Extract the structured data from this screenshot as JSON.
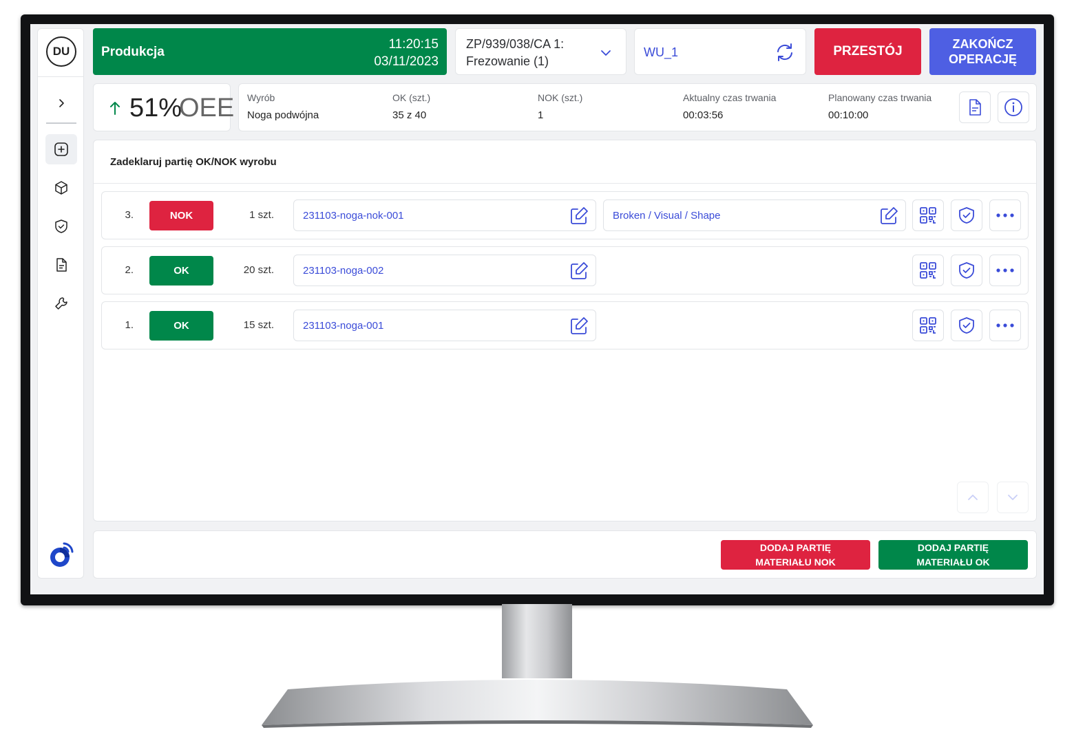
{
  "user": {
    "initials": "DU"
  },
  "status": {
    "label": "Produkcja",
    "time": "11:20:15",
    "date": "03/11/2023"
  },
  "order": {
    "line1": "ZP/939/038/CA 1:",
    "line2": "Frezowanie (1)"
  },
  "workstation": {
    "value": "WU_1"
  },
  "actions": {
    "downtime": "PRZESTÓJ",
    "finish": "ZAKOŃCZ\nOPERACJĘ"
  },
  "oee": {
    "value": "51",
    "percent": "%",
    "unit": "OEE"
  },
  "stats": [
    {
      "label": "Wyrób",
      "value": "Noga podwójna"
    },
    {
      "label": "OK (szt.)",
      "value": "35 z 40"
    },
    {
      "label": "NOK (szt.)",
      "value": "1"
    },
    {
      "label": "Aktualny czas trwania",
      "value": "00:03:56"
    },
    {
      "label": "Planowany czas trwania",
      "value": "00:10:00"
    }
  ],
  "main": {
    "title": "Zadeklaruj partię OK/NOK wyrobu",
    "rows": [
      {
        "num": "3.",
        "status": "NOK",
        "qty": "1",
        "unit": "szt.",
        "batch": "231103-noga-nok-001",
        "reason": "Broken / Visual / Shape"
      },
      {
        "num": "2.",
        "status": "OK",
        "qty": "20",
        "unit": "szt.",
        "batch": "231103-noga-002"
      },
      {
        "num": "1.",
        "status": "OK",
        "qty": "15",
        "unit": "szt.",
        "batch": "231103-noga-001"
      }
    ]
  },
  "footer": {
    "add_nok": "DODAJ PARTIĘ\nMATERIAŁU NOK",
    "add_ok": "DODAJ PARTIĘ\nMATERIAŁU OK"
  },
  "colors": {
    "green": "#00874a",
    "red": "#de2340",
    "blue": "#4e5fe3",
    "link": "#3a4bd8"
  }
}
